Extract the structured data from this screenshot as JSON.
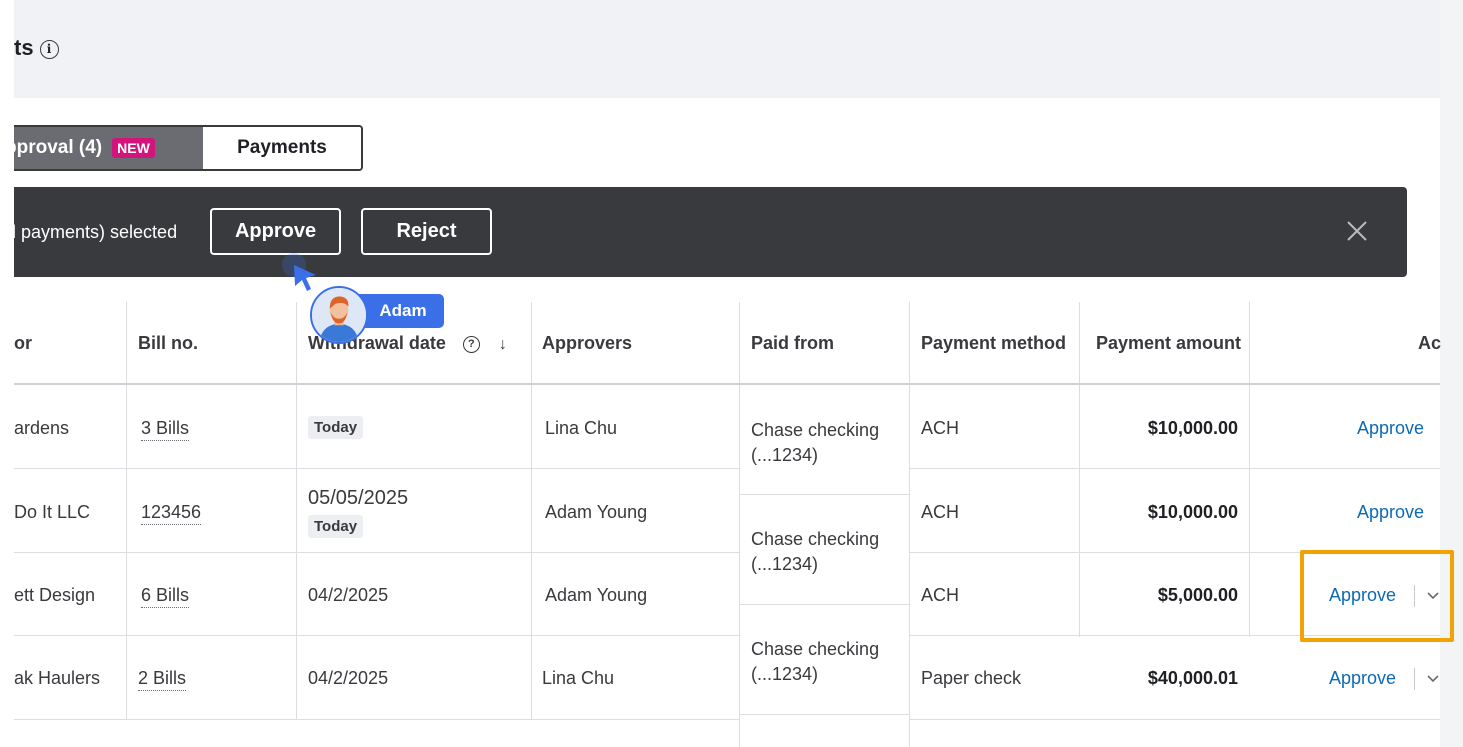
{
  "page": {
    "title": "ts",
    "info_icon": "info-icon"
  },
  "tabs": {
    "approval_label": "pproval (4)",
    "new_badge": "NEW",
    "payments_label": "Payments"
  },
  "action_bar": {
    "selected_text": "ll payments) selected",
    "approve_label": "Approve",
    "reject_label": "Reject",
    "close_icon": "close-icon"
  },
  "collaborator": {
    "name": "Adam",
    "avatar_icon": "avatar"
  },
  "table": {
    "headers": {
      "vendor": "or",
      "bill_no": "Bill no.",
      "withdrawal_date": "Withdrawal date",
      "approvers": "Approvers",
      "paid_from": "Paid from",
      "payment_method": "Payment method",
      "payment_amount": "Payment amount",
      "action": "Ac"
    },
    "rows": [
      {
        "vendor": "ardens",
        "bill_no": "3 Bills",
        "date": "",
        "date_chip": "Today",
        "approvers": "Lina Chu",
        "paid_from": "Chase checking (...1234)",
        "method": "ACH",
        "amount": "$10,000.00",
        "action": "Approve"
      },
      {
        "vendor": "Do It LLC",
        "bill_no": "123456",
        "date": "05/05/2025",
        "date_chip": "Today",
        "approvers": "Adam Young",
        "paid_from": "Chase checking (...1234)",
        "method": "ACH",
        "amount": "$10,000.00",
        "action": "Approve"
      },
      {
        "vendor": "ett Design",
        "bill_no": "6 Bills",
        "date": "04/2/2025",
        "date_chip": "",
        "approvers": "Adam Young",
        "paid_from": "",
        "method": "ACH",
        "amount": "$5,000.00",
        "action": "Approve"
      },
      {
        "vendor": "ak Haulers",
        "bill_no": "2 Bills",
        "date": "04/2/2025",
        "date_chip": "",
        "approvers": "Lina Chu",
        "paid_from": "Chase checking (...1234)",
        "method": "Paper check",
        "amount": "$40,000.01",
        "action": "Approve"
      }
    ]
  },
  "colors": {
    "accent_link": "#0d6ab4",
    "highlight": "#f2a202",
    "badge": "#d4147d",
    "dark_bar": "#393a3d",
    "collab": "#3a6fe8"
  }
}
